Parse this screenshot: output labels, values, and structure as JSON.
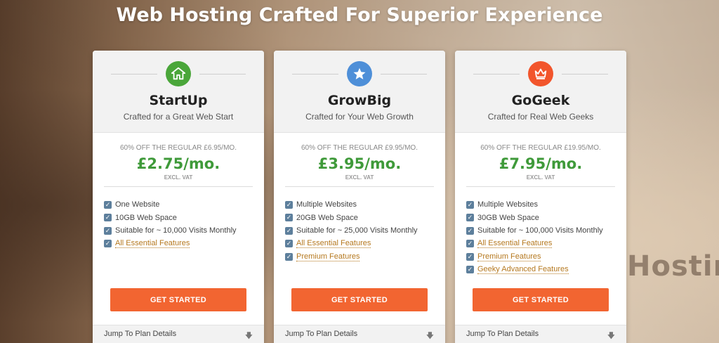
{
  "page": {
    "title": "Web Hosting Crafted For Superior Experience"
  },
  "background": {
    "stamp_text": "Hostin"
  },
  "colors": {
    "cta": "#f26531",
    "price": "#3f9a3a",
    "startup_icon": "#4aa63a",
    "growbig_icon": "#4e8fd8",
    "gogeek_icon": "#f2552c",
    "link": "#b5781f"
  },
  "plans": [
    {
      "icon": "house-icon",
      "name": "StartUp",
      "subtitle": "Crafted for a Great Web Start",
      "regular": "60% OFF THE REGULAR £6.95/MO.",
      "price": "£2.75/mo.",
      "vat": "EXCL. VAT",
      "features": [
        "One Website",
        "10GB Web Space",
        "Suitable for ~ 10,000 Visits Monthly",
        "All Essential Features"
      ],
      "cta": "GET STARTED",
      "jump": "Jump To Plan Details"
    },
    {
      "icon": "star-icon",
      "name": "GrowBig",
      "subtitle": "Crafted for Your Web Growth",
      "regular": "60% OFF THE REGULAR £9.95/MO.",
      "price": "£3.95/mo.",
      "vat": "EXCL. VAT",
      "features": [
        "Multiple Websites",
        "20GB Web Space",
        "Suitable for ~ 25,000 Visits Monthly",
        "All Essential Features",
        "Premium Features"
      ],
      "cta": "GET STARTED",
      "jump": "Jump To Plan Details"
    },
    {
      "icon": "crown-icon",
      "name": "GoGeek",
      "subtitle": "Crafted for Real Web Geeks",
      "regular": "60% OFF THE REGULAR £19.95/MO.",
      "price": "£7.95/mo.",
      "vat": "EXCL. VAT",
      "features": [
        "Multiple Websites",
        "30GB Web Space",
        "Suitable for ~ 100,000 Visits Monthly",
        "All Essential Features",
        "Premium Features",
        "Geeky Advanced Features"
      ],
      "cta": "GET STARTED",
      "jump": "Jump To Plan Details"
    }
  ]
}
